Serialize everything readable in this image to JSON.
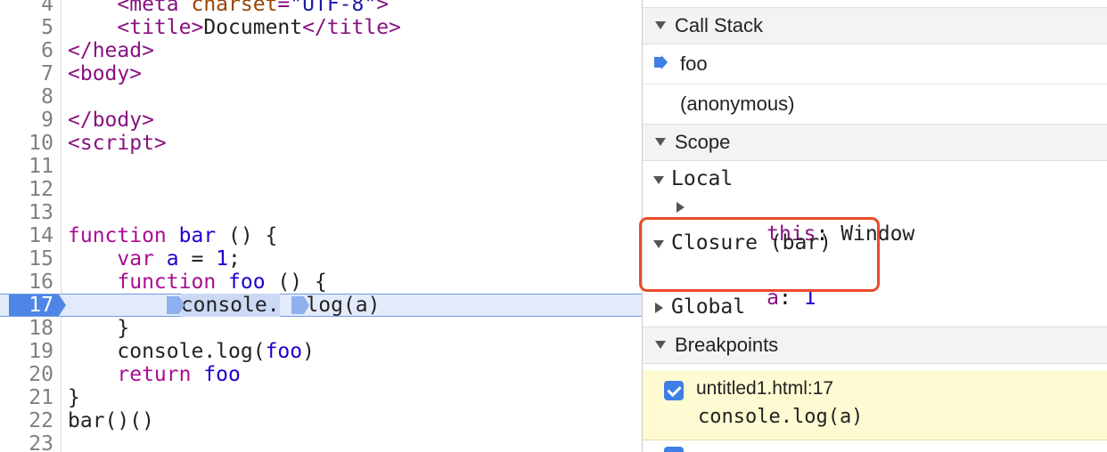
{
  "editor": {
    "lines": [
      {
        "n": "4",
        "tokens": [
          [
            "plain",
            "    "
          ],
          [
            "tag",
            "<meta "
          ],
          [
            "attr",
            "charset"
          ],
          [
            "tag",
            "="
          ],
          [
            "str",
            "\"UTF-8\""
          ],
          [
            "tag",
            ">"
          ]
        ]
      },
      {
        "n": "5",
        "tokens": [
          [
            "plain",
            "    "
          ],
          [
            "tag",
            "<title>"
          ],
          [
            "plain",
            "Document"
          ],
          [
            "tag",
            "</title>"
          ]
        ]
      },
      {
        "n": "6",
        "tokens": [
          [
            "tag",
            "</head>"
          ]
        ]
      },
      {
        "n": "7",
        "tokens": [
          [
            "tag",
            "<body>"
          ]
        ]
      },
      {
        "n": "8",
        "tokens": []
      },
      {
        "n": "9",
        "tokens": [
          [
            "tag",
            "</body>"
          ]
        ]
      },
      {
        "n": "10",
        "tokens": [
          [
            "tag",
            "<script>"
          ]
        ]
      },
      {
        "n": "11",
        "tokens": []
      },
      {
        "n": "12",
        "tokens": []
      },
      {
        "n": "13",
        "tokens": []
      },
      {
        "n": "14",
        "tokens": [
          [
            "kw",
            "function "
          ],
          [
            "fn",
            "bar"
          ],
          [
            "plain",
            " () {"
          ]
        ]
      },
      {
        "n": "15",
        "tokens": [
          [
            "plain",
            "    "
          ],
          [
            "kw",
            "var "
          ],
          [
            "var",
            "a"
          ],
          [
            "plain",
            " = "
          ],
          [
            "num",
            "1"
          ],
          [
            "plain",
            ";"
          ]
        ]
      },
      {
        "n": "16",
        "tokens": [
          [
            "plain",
            "    "
          ],
          [
            "kw",
            "function "
          ],
          [
            "fn",
            "foo"
          ],
          [
            "plain",
            " () {"
          ]
        ]
      },
      {
        "n": "17",
        "tokens": [],
        "exec": true
      },
      {
        "n": "18",
        "tokens": [
          [
            "plain",
            "    }"
          ]
        ]
      },
      {
        "n": "19",
        "tokens": [
          [
            "plain",
            "    console.log("
          ],
          [
            "fn",
            "foo"
          ],
          [
            "plain",
            ")"
          ]
        ]
      },
      {
        "n": "20",
        "tokens": [
          [
            "plain",
            "    "
          ],
          [
            "kw",
            "return "
          ],
          [
            "fn",
            "foo"
          ]
        ]
      },
      {
        "n": "21",
        "tokens": [
          [
            "plain",
            "}"
          ]
        ]
      },
      {
        "n": "22",
        "tokens": [
          [
            "plain",
            "bar()()"
          ]
        ]
      },
      {
        "n": "23",
        "tokens": []
      }
    ],
    "exec_line": {
      "n": "17",
      "part1": "console.",
      "part2": "log(a)"
    }
  },
  "call_stack": {
    "title": "Call Stack",
    "frames": [
      "foo",
      "(anonymous)"
    ]
  },
  "scope": {
    "title": "Scope",
    "local_label": "Local",
    "this_key": "this",
    "this_sep": ": ",
    "this_value": "Window",
    "closure_label": "Closure (bar)",
    "closure_key": "a",
    "closure_sep": ": ",
    "closure_value": "1",
    "global_label": "Global"
  },
  "breakpoints": {
    "title": "Breakpoints",
    "items": [
      {
        "file": "untitled1.html:17",
        "code": "console.log(a)",
        "checked": true
      }
    ]
  },
  "colors": {
    "accent": "#3d7fe6",
    "highlight_box": "#ec4a2a",
    "breakpoint_bg": "#fefbd2"
  }
}
